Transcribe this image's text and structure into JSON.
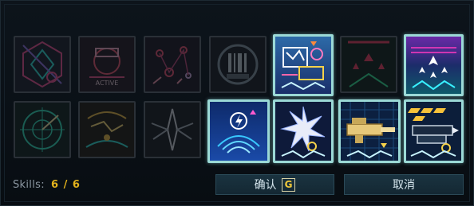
{
  "skills_panel": {
    "label": "Skills:",
    "count": "6 / 6",
    "confirm_label": "确认",
    "confirm_key": "G",
    "cancel_label": "取消",
    "accent": "#e2b21c",
    "selected_border": "#9bd9d6",
    "slots": [
      {
        "icon": "hex-shuriken-icon",
        "selected": false
      },
      {
        "icon": "active-module-icon",
        "selected": false
      },
      {
        "icon": "scatter-network-icon",
        "selected": false
      },
      {
        "icon": "bar-code-ring-icon",
        "selected": false
      },
      {
        "icon": "glyph-board-icon",
        "selected": true
      },
      {
        "icon": "triangle-fleet-icon",
        "selected": false
      },
      {
        "icon": "starship-squadron-icon",
        "selected": true
      },
      {
        "icon": "radar-compass-icon",
        "selected": false
      },
      {
        "icon": "cyber-rift-icon",
        "selected": false
      },
      {
        "icon": "winged-blade-icon",
        "selected": false
      },
      {
        "icon": "lightning-shield-icon",
        "selected": true
      },
      {
        "icon": "star-burst-icon",
        "selected": true
      },
      {
        "icon": "heavy-cannon-icon",
        "selected": true
      },
      {
        "icon": "missile-launcher-icon",
        "selected": true
      }
    ]
  }
}
